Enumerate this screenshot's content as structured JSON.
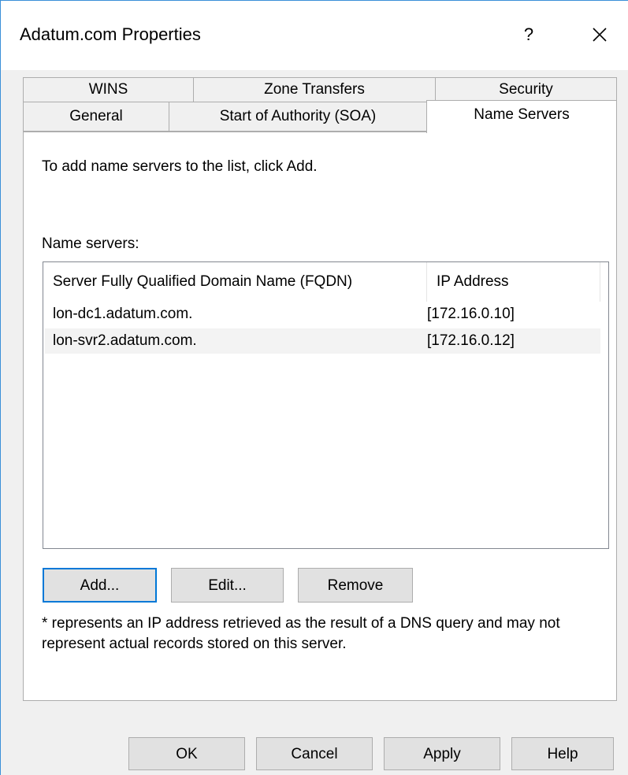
{
  "window": {
    "title": "Adatum.com Properties",
    "help_glyph": "?",
    "close_icon": "close-icon"
  },
  "tabs": {
    "row1": [
      {
        "label": "WINS"
      },
      {
        "label": "Zone Transfers"
      },
      {
        "label": "Security"
      }
    ],
    "row2": [
      {
        "label": "General"
      },
      {
        "label": "Start of Authority (SOA)"
      },
      {
        "label": "Name Servers",
        "active": true
      }
    ]
  },
  "panel": {
    "instruction": "To add name servers to the list, click Add.",
    "list_label": "Name servers:",
    "columns": [
      "Server Fully Qualified Domain Name (FQDN)",
      "IP Address"
    ],
    "rows": [
      {
        "fqdn": "lon-dc1.adatum.com.",
        "ip": "[172.16.0.10]"
      },
      {
        "fqdn": "lon-svr2.adatum.com.",
        "ip": "[172.16.0.12]"
      }
    ],
    "buttons": {
      "add": "Add...",
      "edit": "Edit...",
      "remove": "Remove"
    },
    "note": "* represents an IP address retrieved as the result of a DNS query and may not represent actual records stored on this server."
  },
  "footer": {
    "ok": "OK",
    "cancel": "Cancel",
    "apply": "Apply",
    "help": "Help"
  },
  "colors": {
    "accent": "#0078d7",
    "window_border": "#3a8fd8",
    "dialog_bg": "#f0f0f0",
    "alt_row": "#f3f3f3"
  }
}
